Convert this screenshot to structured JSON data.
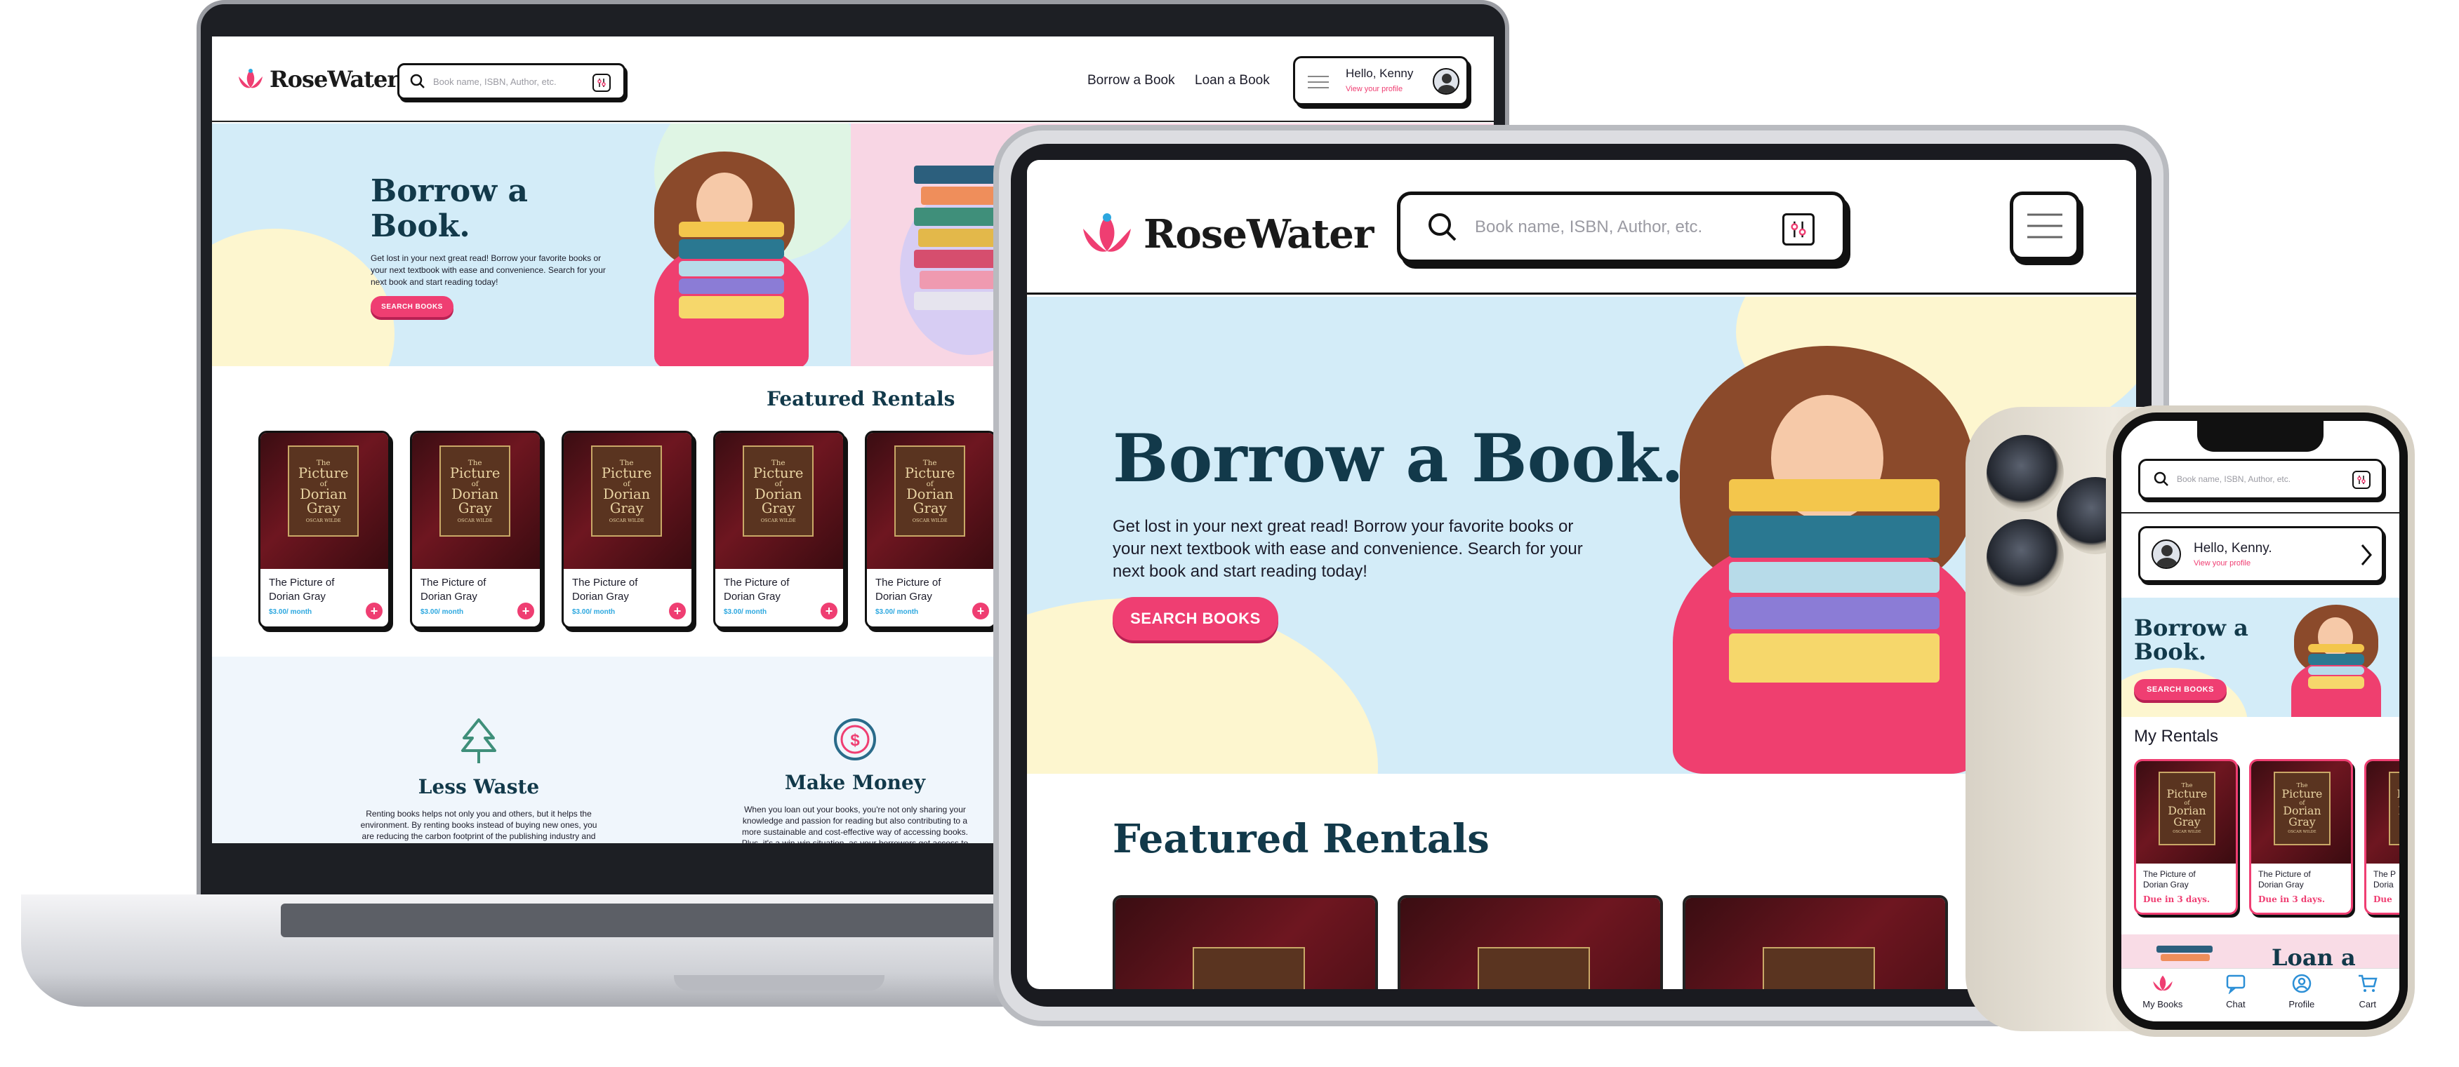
{
  "brand": {
    "name": "RoseWater",
    "accent": "#ef3e72",
    "dark": "#12394a"
  },
  "laptop": {
    "search_placeholder": "Book name, ISBN, Author, etc.",
    "nav": {
      "borrow": "Borrow a Book",
      "loan": "Loan a Book"
    },
    "profile": {
      "greeting": "Hello, Kenny",
      "link": "View your profile"
    },
    "hero": {
      "title_line1": "Borrow a",
      "title_line2": "Book.",
      "body": "Get lost in your next great read! Borrow your favorite books or your next textbook with ease and convenience. Search for your next book and start reading today!",
      "button": "SEARCH BOOKS"
    },
    "featured_title": "Featured Rentals",
    "cards": [
      {
        "title_line1": "The Picture of",
        "title_line2": "Dorian Gray",
        "price": "$3.00/ month"
      },
      {
        "title_line1": "The Picture of",
        "title_line2": "Dorian Gray",
        "price": "$3.00/ month"
      },
      {
        "title_line1": "The Picture of",
        "title_line2": "Dorian Gray",
        "price": "$3.00/ month"
      },
      {
        "title_line1": "The Picture of",
        "title_line2": "Dorian Gray",
        "price": "$3.00/ month"
      },
      {
        "title_line1": "The Picture of",
        "title_line2": "Dorian Gray",
        "price": "$3.00/ month"
      }
    ],
    "book_cover": {
      "line1": "The",
      "line2": "Picture",
      "line3": "of",
      "line4": "Dorian",
      "line5": "Gray",
      "author": "OSCAR WILDE"
    },
    "features": [
      {
        "icon": "tree-icon",
        "title": "Less Waste",
        "body": "Renting books helps not only you and others, but it helps the environment. By renting books instead of buying new ones, you are reducing the carbon footprint of the publishing industry and the demand for paper production. Renting books is a simple and impactful way to make a positive impact on our planet while enjoying the pleasure of reading."
      },
      {
        "icon": "money-icon",
        "title": "Make Money",
        "body": "When you loan out your books, you're not only sharing your knowledge and passion for reading but also contributing to a more sustainable and cost-effective way of accessing books. Plus, it's a win-win situation, as your borrowers get access to books they might not otherwise have been able to afford, while you earn some extra money on the side."
      }
    ]
  },
  "tablet": {
    "search_placeholder": "Book name, ISBN, Author, etc.",
    "hero": {
      "title": "Borrow a Book.",
      "body": "Get lost in your next great read! Borrow your favorite books or your next textbook with ease and convenience. Search for your next book and start reading today!",
      "button": "SEARCH BOOKS"
    },
    "featured_title": "Featured Rentals"
  },
  "phone": {
    "search_placeholder": "Book name, ISBN, Author, etc.",
    "profile": {
      "greeting": "Hello, Kenny.",
      "link": "View your profile"
    },
    "hero": {
      "title_line1": "Borrow a",
      "title_line2": "Book.",
      "button": "SEARCH BOOKS"
    },
    "rentals_title": "My Rentals",
    "rentals": [
      {
        "title_line1": "The Picture of",
        "title_line2": "Dorian Gray",
        "due": "Due in 3 days."
      },
      {
        "title_line1": "The Picture of",
        "title_line2": "Dorian Gray",
        "due": "Due in 3 days."
      },
      {
        "title_line1": "The P",
        "title_line2": "Doria",
        "due": "Due"
      }
    ],
    "loan_teaser": "Loan a",
    "tabs": [
      {
        "label": "My Books",
        "icon": "lotus-icon"
      },
      {
        "label": "Chat",
        "icon": "chat-icon"
      },
      {
        "label": "Profile",
        "icon": "profile-icon"
      },
      {
        "label": "Cart",
        "icon": "cart-icon"
      }
    ]
  }
}
